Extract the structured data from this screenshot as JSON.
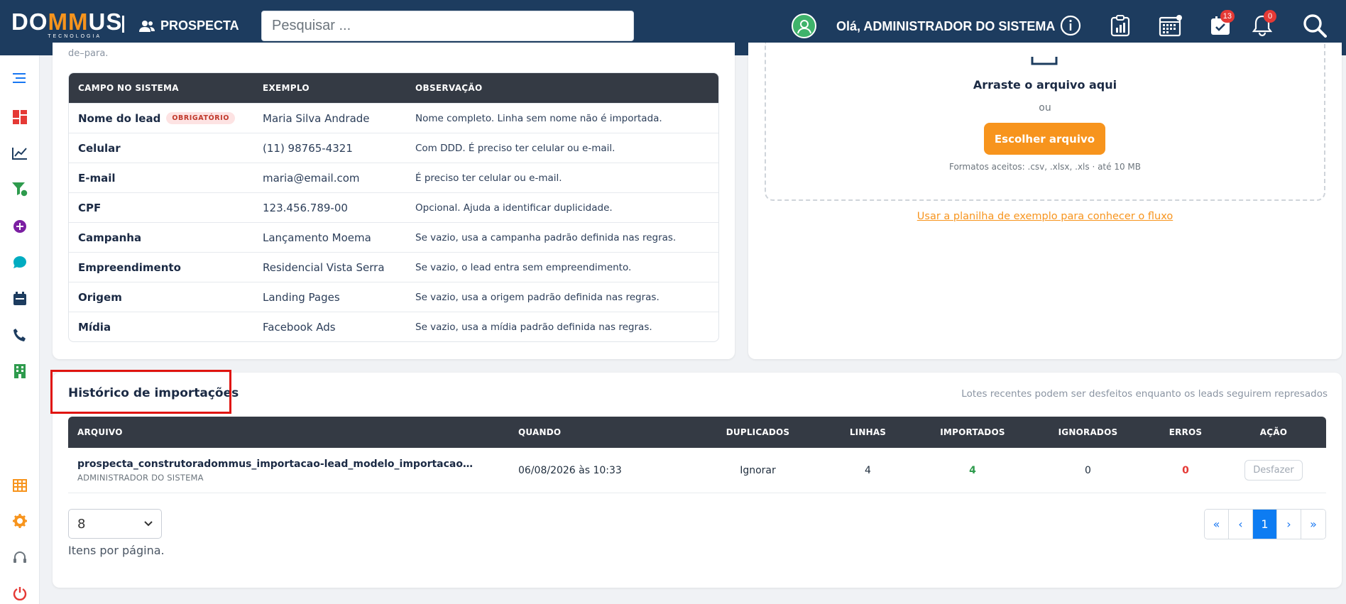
{
  "header": {
    "logo_text_pre": "DO",
    "logo_text_mm": "MM",
    "logo_text_post": "US",
    "logo_sub": "TECNOLOGIA",
    "module_name": "PROSPECTA",
    "search_placeholder": "Pesquisar ...",
    "greeting": "Olá, ADMINISTRADOR DO SISTEMA",
    "icons": [
      "user-circle-icon",
      "info-icon",
      "clipboard-chart-icon",
      "calendar-icon",
      "task-check-icon",
      "bell-icon",
      "search-icon"
    ],
    "tasks_badge": "13",
    "notifications_badge": "0"
  },
  "sidebar": {
    "items": [
      {
        "icon": "menu-icon",
        "color": "#1877f2"
      },
      {
        "icon": "dashboard-icon",
        "color": "#e53935"
      },
      {
        "icon": "chart-line-icon",
        "color": "#1d3c5f"
      },
      {
        "icon": "funnel-icon",
        "color": "#2e9b4d"
      },
      {
        "icon": "plus-circle-icon",
        "color": "#7b1fa2"
      },
      {
        "icon": "chat-icon",
        "color": "#00acc1"
      },
      {
        "icon": "calendar-icon",
        "color": "#1d3c5f"
      },
      {
        "icon": "phone-icon",
        "color": "#1d3c5f"
      },
      {
        "icon": "building-icon",
        "color": "#2e9b4d"
      },
      {
        "icon": "table-icon",
        "color": "#f7941d"
      },
      {
        "icon": "gear-icon",
        "color": "#f7941d"
      },
      {
        "icon": "headset-icon",
        "color": "#6c757d"
      },
      {
        "icon": "power-icon",
        "color": "#e53935"
      }
    ]
  },
  "fields": {
    "cut_text": "de–para.",
    "headers": [
      "CAMPO NO SISTEMA",
      "EXEMPLO",
      "OBSERVAÇÃO"
    ],
    "required_tag": "OBRIGATÓRIO",
    "rows": [
      {
        "field": "Nome do lead",
        "example": "Maria Silva Andrade",
        "note": "Nome completo. Linha sem nome não é importada."
      },
      {
        "field": "Celular",
        "example": "(11) 98765-4321",
        "note": "Com DDD. É preciso ter celular ou e-mail."
      },
      {
        "field": "E-mail",
        "example": "maria@email.com",
        "note": "É preciso ter celular ou e-mail."
      },
      {
        "field": "CPF",
        "example": "123.456.789-00",
        "note": "Opcional. Ajuda a identificar duplicidade."
      },
      {
        "field": "Campanha",
        "example": "Lançamento Moema",
        "note": "Se vazio, usa a campanha padrão definida nas regras."
      },
      {
        "field": "Empreendimento",
        "example": "Residencial Vista Serra",
        "note": "Se vazio, o lead entra sem empreendimento."
      },
      {
        "field": "Origem",
        "example": "Landing Pages",
        "note": "Se vazio, usa a origem padrão definida nas regras."
      },
      {
        "field": "Mídia",
        "example": "Facebook Ads",
        "note": "Se vazio, usa a mídia padrão definida nas regras."
      }
    ]
  },
  "upload": {
    "title": "Arraste o arquivo aqui",
    "or": "ou",
    "button": "Escolher arquivo",
    "formats": "Formatos aceitos: .csv, .xlsx, .xls · até 10 MB",
    "example_link": "Usar a planilha de exemplo para conhecer o fluxo"
  },
  "history": {
    "title": "Histórico de importações",
    "note": "Lotes recentes podem ser desfeitos enquanto os leads seguirem represados",
    "headers": [
      "ARQUIVO",
      "QUANDO",
      "DUPLICADOS",
      "LINHAS",
      "IMPORTADOS",
      "IGNORADOS",
      "ERROS",
      "AÇÃO"
    ],
    "rows": [
      {
        "file": "prospecta_construtoradommus_importacao-lead_modelo_importacao_lead_exemplo.xlsx",
        "user": "ADMINISTRADOR DO SISTEMA",
        "when": "06/08/2026 às 10:33",
        "duplicates": "Ignorar",
        "lines": "4",
        "imported": "4",
        "ignored": "0",
        "errors": "0",
        "action": "Desfazer"
      }
    ],
    "per_page": "8",
    "per_page_label": "Itens por página.",
    "pagination": [
      "«",
      "‹",
      "1",
      "›",
      "»"
    ],
    "current_page": "1"
  },
  "colors": {
    "topbar": "#1d3c5f",
    "accent": "#f7941d",
    "table_head": "#343a44",
    "highlight_box": "#e0140f",
    "active_page": "#0d7cf2"
  }
}
